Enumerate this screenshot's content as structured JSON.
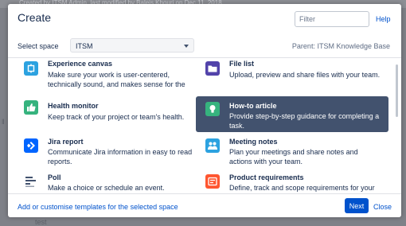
{
  "background": {
    "header_text": "Created by ITSM Admin, last modified by Baleis Khouri on Dec 11, 2018",
    "side_glyph": "‖",
    "bottom_text": "test"
  },
  "dialog": {
    "title": "Create",
    "filter_placeholder": "Filter",
    "help_label": "Help",
    "space_label": "Select space",
    "space_value": "ITSM",
    "parent_label": "Parent: ITSM Knowledge Base",
    "footer_link": "Add or customise templates for the selected space",
    "next_label": "Next",
    "close_label": "Close"
  },
  "templates": [
    {
      "name": "Experience canvas",
      "desc": "Make sure your work is user-centered, technically sound, and makes sense for the",
      "icon": "canvas-icon",
      "color": "#2ca2e0"
    },
    {
      "name": "File list",
      "desc": "Upload, preview and share files with your team.",
      "icon": "folder-icon",
      "color": "#5243aa"
    },
    {
      "name": "Health monitor",
      "desc": "Keep track of your project or team's health.",
      "icon": "thumbs-up-icon",
      "color": "#36b37e"
    },
    {
      "name": "How-to article",
      "desc": "Provide step-by-step guidance for completing a task.",
      "icon": "lightbulb-icon",
      "color": "#36b37e"
    },
    {
      "name": "Jira report",
      "desc": "Communicate Jira information in easy to read reports.",
      "icon": "jira-icon",
      "color": "#0065ff"
    },
    {
      "name": "Meeting notes",
      "desc": "Plan your meetings and share notes and actions with your team.",
      "icon": "people-icon",
      "color": "#2ca2e0"
    },
    {
      "name": "Poll",
      "desc": "Make a choice or schedule an event.",
      "icon": "poll-icon",
      "color": "#ffffff"
    },
    {
      "name": "Product requirements",
      "desc": "Define, track and scope requirements for your product or features.",
      "icon": "requirements-icon",
      "color": "#ff5630"
    }
  ]
}
